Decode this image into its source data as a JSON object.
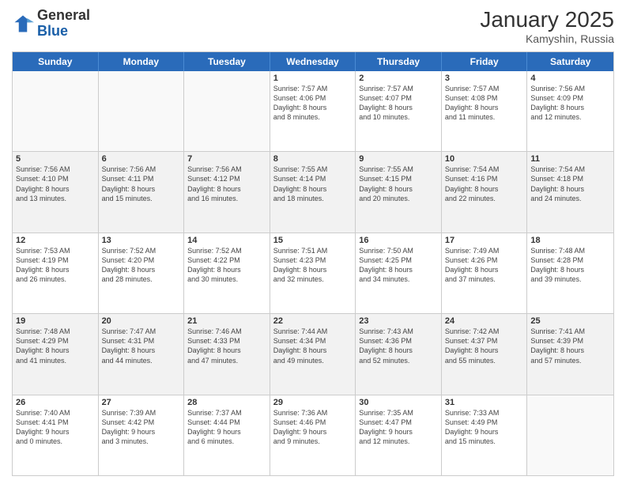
{
  "logo": {
    "general": "General",
    "blue": "Blue"
  },
  "title": "January 2025",
  "subtitle": "Kamyshin, Russia",
  "weekdays": [
    "Sunday",
    "Monday",
    "Tuesday",
    "Wednesday",
    "Thursday",
    "Friday",
    "Saturday"
  ],
  "rows": [
    [
      {
        "day": "",
        "info": "",
        "empty": true
      },
      {
        "day": "",
        "info": "",
        "empty": true
      },
      {
        "day": "",
        "info": "",
        "empty": true
      },
      {
        "day": "1",
        "info": "Sunrise: 7:57 AM\nSunset: 4:06 PM\nDaylight: 8 hours\nand 8 minutes."
      },
      {
        "day": "2",
        "info": "Sunrise: 7:57 AM\nSunset: 4:07 PM\nDaylight: 8 hours\nand 10 minutes."
      },
      {
        "day": "3",
        "info": "Sunrise: 7:57 AM\nSunset: 4:08 PM\nDaylight: 8 hours\nand 11 minutes."
      },
      {
        "day": "4",
        "info": "Sunrise: 7:56 AM\nSunset: 4:09 PM\nDaylight: 8 hours\nand 12 minutes."
      }
    ],
    [
      {
        "day": "5",
        "info": "Sunrise: 7:56 AM\nSunset: 4:10 PM\nDaylight: 8 hours\nand 13 minutes."
      },
      {
        "day": "6",
        "info": "Sunrise: 7:56 AM\nSunset: 4:11 PM\nDaylight: 8 hours\nand 15 minutes."
      },
      {
        "day": "7",
        "info": "Sunrise: 7:56 AM\nSunset: 4:12 PM\nDaylight: 8 hours\nand 16 minutes."
      },
      {
        "day": "8",
        "info": "Sunrise: 7:55 AM\nSunset: 4:14 PM\nDaylight: 8 hours\nand 18 minutes."
      },
      {
        "day": "9",
        "info": "Sunrise: 7:55 AM\nSunset: 4:15 PM\nDaylight: 8 hours\nand 20 minutes."
      },
      {
        "day": "10",
        "info": "Sunrise: 7:54 AM\nSunset: 4:16 PM\nDaylight: 8 hours\nand 22 minutes."
      },
      {
        "day": "11",
        "info": "Sunrise: 7:54 AM\nSunset: 4:18 PM\nDaylight: 8 hours\nand 24 minutes."
      }
    ],
    [
      {
        "day": "12",
        "info": "Sunrise: 7:53 AM\nSunset: 4:19 PM\nDaylight: 8 hours\nand 26 minutes."
      },
      {
        "day": "13",
        "info": "Sunrise: 7:52 AM\nSunset: 4:20 PM\nDaylight: 8 hours\nand 28 minutes."
      },
      {
        "day": "14",
        "info": "Sunrise: 7:52 AM\nSunset: 4:22 PM\nDaylight: 8 hours\nand 30 minutes."
      },
      {
        "day": "15",
        "info": "Sunrise: 7:51 AM\nSunset: 4:23 PM\nDaylight: 8 hours\nand 32 minutes."
      },
      {
        "day": "16",
        "info": "Sunrise: 7:50 AM\nSunset: 4:25 PM\nDaylight: 8 hours\nand 34 minutes."
      },
      {
        "day": "17",
        "info": "Sunrise: 7:49 AM\nSunset: 4:26 PM\nDaylight: 8 hours\nand 37 minutes."
      },
      {
        "day": "18",
        "info": "Sunrise: 7:48 AM\nSunset: 4:28 PM\nDaylight: 8 hours\nand 39 minutes."
      }
    ],
    [
      {
        "day": "19",
        "info": "Sunrise: 7:48 AM\nSunset: 4:29 PM\nDaylight: 8 hours\nand 41 minutes."
      },
      {
        "day": "20",
        "info": "Sunrise: 7:47 AM\nSunset: 4:31 PM\nDaylight: 8 hours\nand 44 minutes."
      },
      {
        "day": "21",
        "info": "Sunrise: 7:46 AM\nSunset: 4:33 PM\nDaylight: 8 hours\nand 47 minutes."
      },
      {
        "day": "22",
        "info": "Sunrise: 7:44 AM\nSunset: 4:34 PM\nDaylight: 8 hours\nand 49 minutes."
      },
      {
        "day": "23",
        "info": "Sunrise: 7:43 AM\nSunset: 4:36 PM\nDaylight: 8 hours\nand 52 minutes."
      },
      {
        "day": "24",
        "info": "Sunrise: 7:42 AM\nSunset: 4:37 PM\nDaylight: 8 hours\nand 55 minutes."
      },
      {
        "day": "25",
        "info": "Sunrise: 7:41 AM\nSunset: 4:39 PM\nDaylight: 8 hours\nand 57 minutes."
      }
    ],
    [
      {
        "day": "26",
        "info": "Sunrise: 7:40 AM\nSunset: 4:41 PM\nDaylight: 9 hours\nand 0 minutes."
      },
      {
        "day": "27",
        "info": "Sunrise: 7:39 AM\nSunset: 4:42 PM\nDaylight: 9 hours\nand 3 minutes."
      },
      {
        "day": "28",
        "info": "Sunrise: 7:37 AM\nSunset: 4:44 PM\nDaylight: 9 hours\nand 6 minutes."
      },
      {
        "day": "29",
        "info": "Sunrise: 7:36 AM\nSunset: 4:46 PM\nDaylight: 9 hours\nand 9 minutes."
      },
      {
        "day": "30",
        "info": "Sunrise: 7:35 AM\nSunset: 4:47 PM\nDaylight: 9 hours\nand 12 minutes."
      },
      {
        "day": "31",
        "info": "Sunrise: 7:33 AM\nSunset: 4:49 PM\nDaylight: 9 hours\nand 15 minutes."
      },
      {
        "day": "",
        "info": "",
        "empty": true
      }
    ]
  ]
}
